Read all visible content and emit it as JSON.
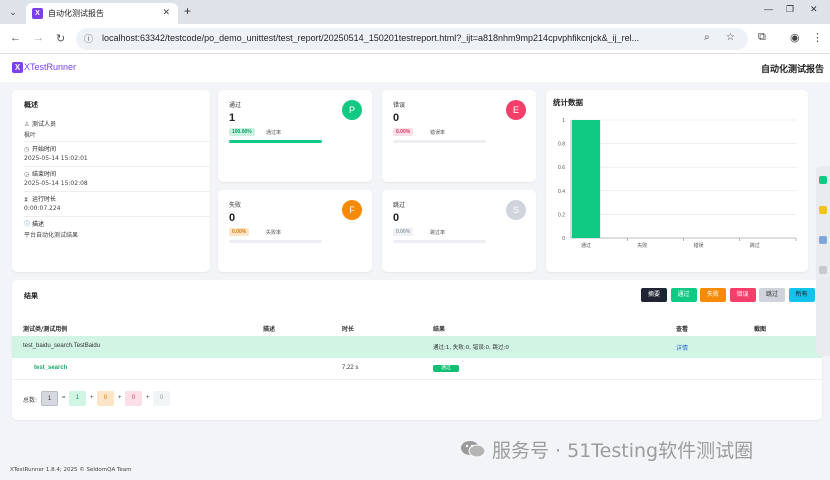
{
  "browser": {
    "tab_title": "自动化测试报告",
    "favicon_letter": "X",
    "url": "localhost:63342/testcode/po_demo_unittest/test_report/20250514_150201testreport.html?_ijt=a818nhm9mp214cpvphfikcnjck&_ij_rel..."
  },
  "header": {
    "logo_letter": "X",
    "brand": "XTestRunner",
    "title": "自动化测试报告"
  },
  "overview": {
    "heading": "概述",
    "rows": [
      {
        "label": "测试人员",
        "value": "枫叶"
      },
      {
        "label": "开始时间",
        "value": "2025-05-14 15:02:01"
      },
      {
        "label": "结束时间",
        "value": "2025-05-14 15:02:08"
      },
      {
        "label": "运行时长",
        "value": "0:00:07.224"
      },
      {
        "label": "描述",
        "value": "平台自动化测试结果"
      }
    ]
  },
  "stats": {
    "pass": {
      "label": "通过",
      "count": "1",
      "letter": "P",
      "badge": "100.00%",
      "sub": "通过率",
      "rate": 1.0,
      "color": "#10c983"
    },
    "error": {
      "label": "错误",
      "count": "0",
      "letter": "E",
      "badge": "0.00%",
      "sub": "错误率",
      "rate": 0,
      "color": "#f43f6a"
    },
    "fail": {
      "label": "失败",
      "count": "0",
      "letter": "F",
      "badge": "0.00%",
      "sub": "失败率",
      "rate": 0,
      "color": "#f58a07"
    },
    "skip": {
      "label": "跳过",
      "count": "0",
      "letter": "S",
      "badge": "0.00%",
      "sub": "跳过率",
      "rate": 0,
      "color": "#cfd4dc"
    }
  },
  "chart_data": {
    "type": "bar",
    "title": "统计数据",
    "categories": [
      "通过",
      "失败",
      "错误",
      "跳过"
    ],
    "values": [
      1,
      0,
      0,
      0
    ],
    "ylim": [
      0,
      1
    ],
    "yticks": [
      "0",
      "0.2",
      "0.4",
      "0.6",
      "0.8",
      "1"
    ],
    "grid": true,
    "color": "#10c983"
  },
  "results": {
    "heading": "结果",
    "filters": [
      {
        "label": "摘要",
        "color": "#1f2433"
      },
      {
        "label": "通过",
        "color": "#10c983"
      },
      {
        "label": "失败",
        "color": "#f58a07"
      },
      {
        "label": "错误",
        "color": "#f43f6a"
      },
      {
        "label": "跳过",
        "color": "#cfd4dc"
      },
      {
        "label": "所有",
        "color": "#11c4ee"
      }
    ],
    "columns": {
      "case": "测试类/测试用例",
      "desc": "描述",
      "duration": "时长",
      "result": "结果",
      "view": "查看",
      "screenshot": "截图"
    },
    "class_row": {
      "name": "test_baidu_search.TestBaidu",
      "stats": "通过:1, 失败:0, 错误:0, 跳过:0",
      "detail": "详情"
    },
    "case_row": {
      "name": "test_search",
      "duration": "7.22 s",
      "status": "通过"
    },
    "summary": {
      "label": "总数:",
      "total": "1",
      "pass": "1",
      "fail": "0",
      "error": "0",
      "skip": "0",
      "eq": "=",
      "plus": "+"
    }
  },
  "footer": "XTestRunner 1.8.4; 2025 © SeldomQA Team",
  "watermark": "服务号 · 51Testing软件测试圈"
}
